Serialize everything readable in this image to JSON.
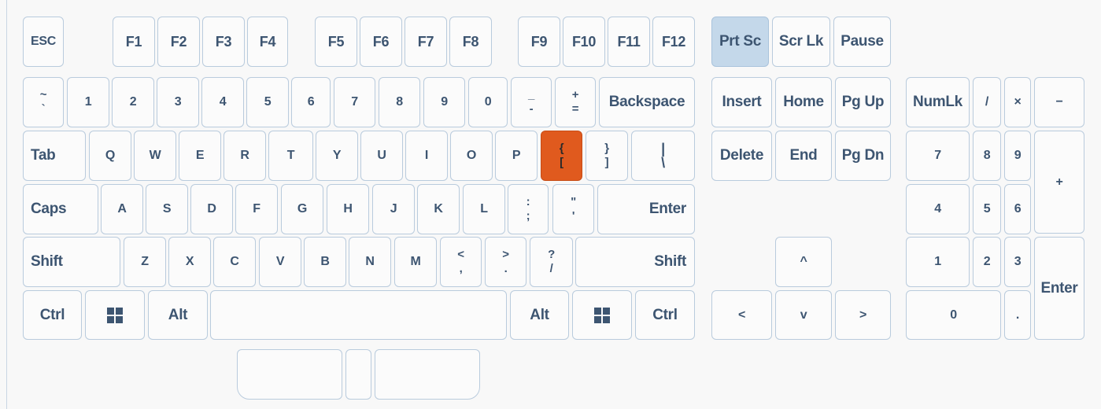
{
  "function_row": {
    "esc": "ESC",
    "f1": "F1",
    "f2": "F2",
    "f3": "F3",
    "f4": "F4",
    "f5": "F5",
    "f6": "F6",
    "f7": "F7",
    "f8": "F8",
    "f9": "F9",
    "f10": "F10",
    "f11": "F11",
    "f12": "F12",
    "prtsc": "Prt Sc",
    "scrlk": "Scr Lk",
    "pause": "Pause"
  },
  "number_row": {
    "tilde_top": "~",
    "tilde_bottom": "`",
    "k1": "1",
    "k2": "2",
    "k3": "3",
    "k4": "4",
    "k5": "5",
    "k6": "6",
    "k7": "7",
    "k8": "8",
    "k9": "9",
    "k0": "0",
    "minus_top": "_",
    "minus_bottom": "-",
    "equal_top": "+",
    "equal_bottom": "=",
    "backspace": "Backspace"
  },
  "top_row": {
    "tab": "Tab",
    "q": "Q",
    "w": "W",
    "e": "E",
    "r": "R",
    "t": "T",
    "y": "Y",
    "u": "U",
    "i": "I",
    "o": "O",
    "p": "P",
    "lbracket_top": "{",
    "lbracket_bottom": "[",
    "rbracket_top": "}",
    "rbracket_bottom": "]",
    "backslash_top": "|",
    "backslash_bottom": "\\"
  },
  "home_row": {
    "caps": "Caps",
    "a": "A",
    "s": "S",
    "d": "D",
    "f": "F",
    "g": "G",
    "h": "H",
    "j": "J",
    "k": "K",
    "l": "L",
    "semicolon_top": ":",
    "semicolon_bottom": ";",
    "quote_top": "\"",
    "quote_bottom": "'",
    "enter": "Enter"
  },
  "bottom_row": {
    "lshift": "Shift",
    "z": "Z",
    "x": "X",
    "c": "C",
    "v": "V",
    "b": "B",
    "n": "N",
    "m": "M",
    "comma_top": "<",
    "comma_bottom": ",",
    "period_top": ">",
    "period_bottom": ".",
    "slash_top": "?",
    "slash_bottom": "/",
    "rshift": "Shift"
  },
  "space_row": {
    "lctrl": "Ctrl",
    "lalt": "Alt",
    "ralt": "Alt",
    "rctrl": "Ctrl",
    "space": ""
  },
  "nav_cluster": {
    "insert": "Insert",
    "home": "Home",
    "pgup": "Pg Up",
    "delete": "Delete",
    "end": "End",
    "pgdn": "Pg Dn",
    "up": "^",
    "left": "<",
    "down": "v",
    "right": ">"
  },
  "numpad": {
    "numlk": "NumLk",
    "divide": "/",
    "multiply": "×",
    "minus": "−",
    "n7": "7",
    "n8": "8",
    "n9": "9",
    "plus": "+",
    "n4": "4",
    "n5": "5",
    "n6": "6",
    "n1": "1",
    "n2": "2",
    "n3": "3",
    "enter": "Enter",
    "n0": "0",
    "decimal": "."
  },
  "state": {
    "highlighted_key": "Prt Sc",
    "active_key": "{ ["
  },
  "colors": {
    "key_border": "#b9cbdd",
    "key_text": "#3d5571",
    "highlight": "#c4d8ea",
    "active": "#e05a1e"
  }
}
